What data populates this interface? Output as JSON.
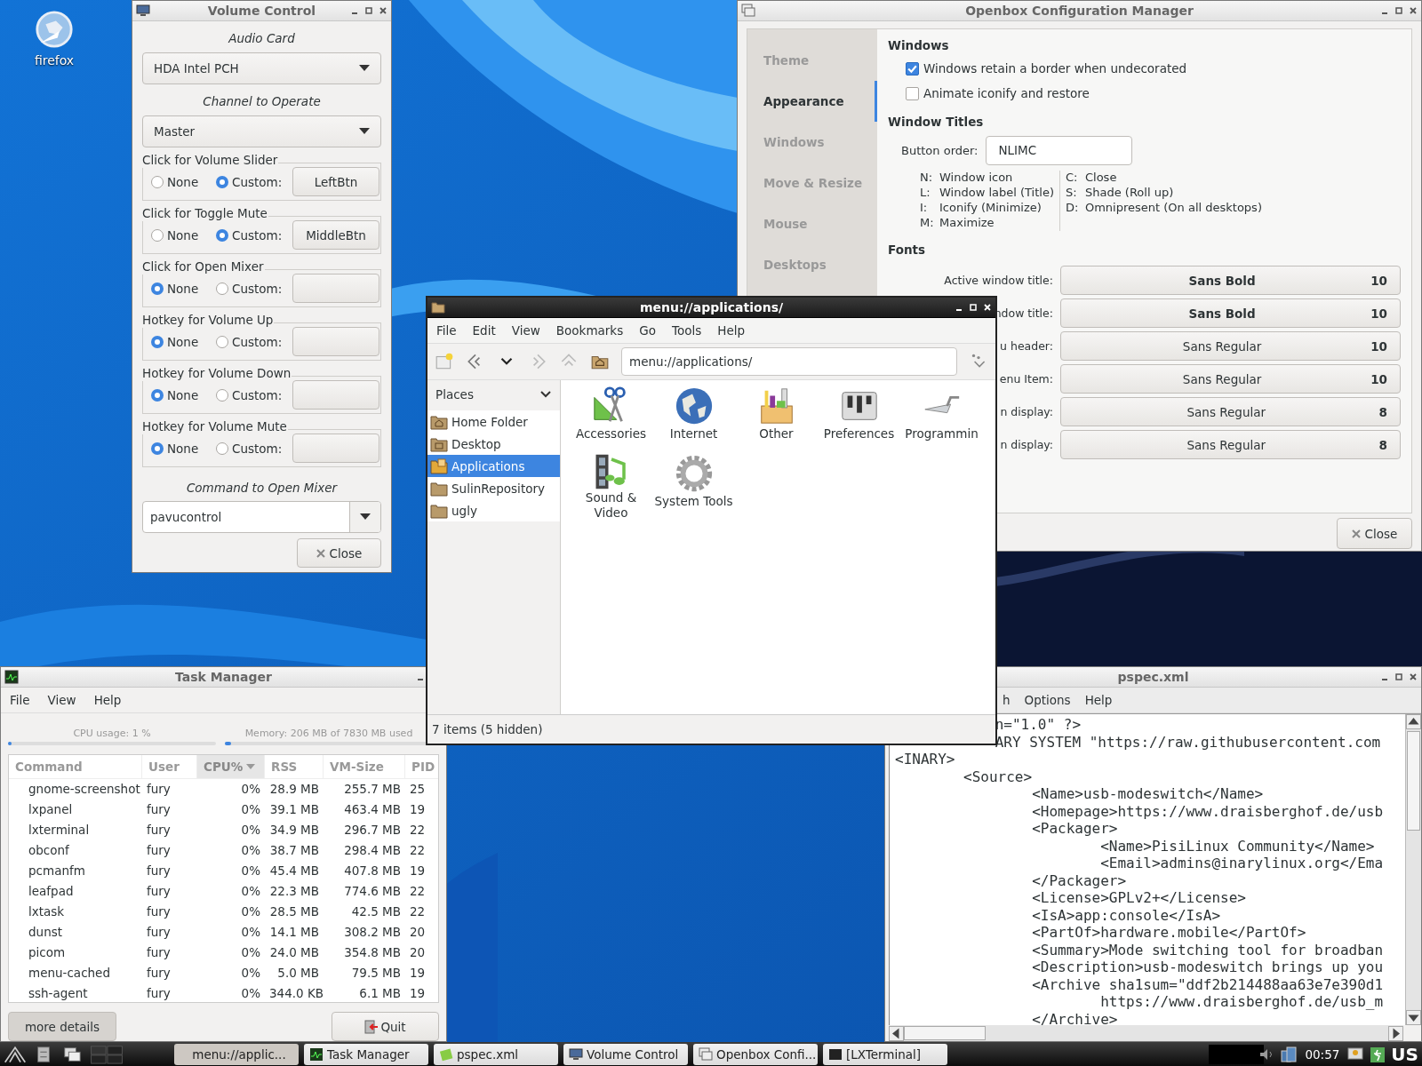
{
  "desktop": {
    "icons": [
      {
        "label": "firefox"
      }
    ]
  },
  "volume_control": {
    "title": "Volume Control",
    "audio_card_label": "Audio Card",
    "audio_card": "HDA Intel PCH",
    "channel_label": "Channel to Operate",
    "channel": "Master",
    "bindings": [
      {
        "label": "Click for Volume Slider",
        "options": [
          {
            "label": "None",
            "selected": false
          },
          {
            "label": "Custom:",
            "selected": true
          }
        ],
        "key": "LeftBtn"
      },
      {
        "label": "Click for Toggle Mute",
        "options": [
          {
            "label": "None",
            "selected": false
          },
          {
            "label": "Custom:",
            "selected": true
          }
        ],
        "key": "MiddleBtn"
      },
      {
        "label": "Click for Open Mixer",
        "options": [
          {
            "label": "None",
            "selected": true
          },
          {
            "label": "Custom:",
            "selected": false
          }
        ]
      },
      {
        "label": "Hotkey for Volume Up",
        "options": [
          {
            "label": "None",
            "selected": true
          },
          {
            "label": "Custom:",
            "selected": false
          }
        ]
      },
      {
        "label": "Hotkey for Volume Down",
        "options": [
          {
            "label": "None",
            "selected": true
          },
          {
            "label": "Custom:",
            "selected": false
          }
        ]
      },
      {
        "label": "Hotkey for Volume Mute",
        "options": [
          {
            "label": "None",
            "selected": true
          },
          {
            "label": "Custom:",
            "selected": false
          }
        ]
      }
    ],
    "command_label": "Command to Open Mixer",
    "command": "pavucontrol",
    "close": "Close"
  },
  "openbox": {
    "title": "Openbox Configuration Manager",
    "sections": [
      {
        "label": "Theme",
        "selected": false
      },
      {
        "label": "Appearance",
        "selected": true
      },
      {
        "label": "Windows",
        "selected": false
      },
      {
        "label": "Move & Resize",
        "selected": false
      },
      {
        "label": "Mouse",
        "selected": false
      },
      {
        "label": "Desktops",
        "selected": false
      }
    ],
    "windows_heading": "Windows",
    "checkboxes": [
      {
        "label": "Windows retain a border when undecorated",
        "checked": true
      },
      {
        "label": "Animate iconify and restore",
        "checked": false
      }
    ],
    "titles_heading": "Window Titles",
    "button_order_label": "Button order:",
    "button_order": "NLIMC",
    "legend_left": [
      {
        "key": "N:",
        "text": "Window icon"
      },
      {
        "key": "L:",
        "text": "Window label (Title)"
      },
      {
        "key": "I:",
        "text": "Iconify (Minimize)"
      },
      {
        "key": "M:",
        "text": "Maximize"
      }
    ],
    "legend_right": [
      {
        "key": "C:",
        "text": "Close"
      },
      {
        "key": "S:",
        "text": "Shade (Roll up)"
      },
      {
        "key": "D:",
        "text": "Omnipresent (On all desktops)"
      }
    ],
    "fonts_heading": "Fonts",
    "fonts": [
      {
        "label": "Active window title:",
        "font": "Sans Bold",
        "size": "10",
        "bold": true
      },
      {
        "label": "ndow title:",
        "font": "Sans Bold",
        "size": "10",
        "bold": true
      },
      {
        "label": "u header:",
        "font": "Sans Regular",
        "size": "10",
        "bold": false
      },
      {
        "label": "enu Item:",
        "font": "Sans Regular",
        "size": "10",
        "bold": false
      },
      {
        "label": "n display:",
        "font": "Sans Regular",
        "size": "8",
        "bold": false
      },
      {
        "label": "n display:",
        "font": "Sans Regular",
        "size": "8",
        "bold": false
      }
    ],
    "close": "Close"
  },
  "task_manager": {
    "title": "Task Manager",
    "menu": [
      "File",
      "View",
      "Help"
    ],
    "cpu": {
      "label": "CPU usage: 1 %",
      "level": 0.01
    },
    "memory": {
      "label": "Memory: 206 MB of 7830 MB used",
      "level": 0.03
    },
    "columns": [
      {
        "label": "Command",
        "sorted": false
      },
      {
        "label": "User",
        "sorted": false
      },
      {
        "label": "CPU%",
        "sorted": true
      },
      {
        "label": "RSS",
        "sorted": false
      },
      {
        "label": "VM-Size",
        "sorted": false
      },
      {
        "label": "PID",
        "sorted": false
      }
    ],
    "rows": [
      [
        "gnome-screenshot",
        "fury",
        "0%",
        "28.9 MB",
        "255.7 MB",
        "25"
      ],
      [
        "lxpanel",
        "fury",
        "0%",
        "39.1 MB",
        "463.4 MB",
        "19"
      ],
      [
        "lxterminal",
        "fury",
        "0%",
        "34.9 MB",
        "296.7 MB",
        "22"
      ],
      [
        "obconf",
        "fury",
        "0%",
        "38.7 MB",
        "298.4 MB",
        "22"
      ],
      [
        "pcmanfm",
        "fury",
        "0%",
        "45.4 MB",
        "407.8 MB",
        "19"
      ],
      [
        "leafpad",
        "fury",
        "0%",
        "22.3 MB",
        "774.6 MB",
        "22"
      ],
      [
        "lxtask",
        "fury",
        "0%",
        "28.5 MB",
        "42.5 MB",
        "22"
      ],
      [
        "dunst",
        "fury",
        "0%",
        "14.1 MB",
        "308.2 MB",
        "20"
      ],
      [
        "picom",
        "fury",
        "0%",
        "24.0 MB",
        "354.8 MB",
        "20"
      ],
      [
        "menu-cached",
        "fury",
        "0%",
        "5.0 MB",
        "79.5 MB",
        "19"
      ],
      [
        "ssh-agent",
        "fury",
        "0%",
        "344.0 KB",
        "6.1 MB",
        "19"
      ]
    ],
    "details_button": "more details",
    "quit_button": "Quit"
  },
  "editor": {
    "title": "pspec.xml",
    "menu": [
      "h",
      "Options",
      "Help"
    ],
    "lines": [
      {
        "text": "n=\"1.0\" ?>",
        "covered": true
      },
      {
        "text": "ARY SYSTEM \"https://raw.githubusercontent.com",
        "covered": true
      },
      {
        "text": "<INARY>",
        "covered": false
      },
      {
        "text": "\t<Source>",
        "covered": false
      },
      {
        "text": "\t\t<Name>usb-modeswitch</Name>",
        "covered": false
      },
      {
        "text": "\t\t<Homepage>https://www.draisberghof.de/usb",
        "covered": false
      },
      {
        "text": "\t\t<Packager>",
        "covered": false
      },
      {
        "text": "\t\t\t<Name>PisiLinux Community</Name>",
        "covered": false
      },
      {
        "text": "\t\t\t<Email>admins@inarylinux.org</Ema",
        "covered": false
      },
      {
        "text": "\t\t</Packager>",
        "covered": false
      },
      {
        "text": "\t\t<License>GPLv2+</License>",
        "covered": false
      },
      {
        "text": "\t\t<IsA>app:console</IsA>",
        "covered": false
      },
      {
        "text": "\t\t<PartOf>hardware.mobile</PartOf>",
        "covered": false
      },
      {
        "text": "\t\t<Summary>Mode switching tool for broadban",
        "covered": false
      },
      {
        "text": "\t\t<Description>usb-modeswitch brings up you",
        "covered": false
      },
      {
        "text": "\t\t<Archive sha1sum=\"ddf2b214488aa63e7e390d1",
        "covered": false
      },
      {
        "text": "\t\t\thttps://www.draisberghof.de/usb_m",
        "covered": false
      },
      {
        "text": "\t\t</Archive>",
        "covered": false
      }
    ]
  },
  "file_manager": {
    "title": "menu://applications/",
    "menu": [
      "File",
      "Edit",
      "View",
      "Bookmarks",
      "Go",
      "Tools",
      "Help"
    ],
    "path": "menu://applications/",
    "places_label": "Places",
    "places": [
      {
        "label": "Home Folder",
        "kind": "home",
        "selected": false
      },
      {
        "label": "Desktop",
        "kind": "desktop",
        "selected": false
      },
      {
        "label": "Applications",
        "kind": "applications",
        "selected": true
      },
      {
        "label": "SulinRepository",
        "kind": "folder",
        "selected": false
      },
      {
        "label": "ugly",
        "kind": "folder",
        "selected": false
      }
    ],
    "items": [
      {
        "label": "Accessories",
        "kind": "accessories"
      },
      {
        "label": "Internet",
        "kind": "internet"
      },
      {
        "label": "Other",
        "kind": "other"
      },
      {
        "label": "Preferences",
        "kind": "preferences"
      },
      {
        "label": "Programmin",
        "kind": "programming"
      },
      {
        "label": "Sound & Video",
        "kind": "sound"
      },
      {
        "label": "System Tools",
        "kind": "system"
      }
    ],
    "status": "7 items (5 hidden)"
  },
  "taskbar": {
    "tasks": [
      {
        "label": "menu://applic...",
        "kind": "folder",
        "selected": true
      },
      {
        "label": "Task Manager",
        "kind": "chart",
        "selected": false
      },
      {
        "label": "pspec.xml",
        "kind": "pad",
        "selected": false
      },
      {
        "label": "Volume Control",
        "kind": "monitor",
        "selected": false
      },
      {
        "label": "Openbox Confi...",
        "kind": "windows",
        "selected": false
      },
      {
        "label": "[LXTerminal]",
        "kind": "terminal",
        "selected": false
      }
    ],
    "clock": "00:57",
    "layout": "US"
  }
}
